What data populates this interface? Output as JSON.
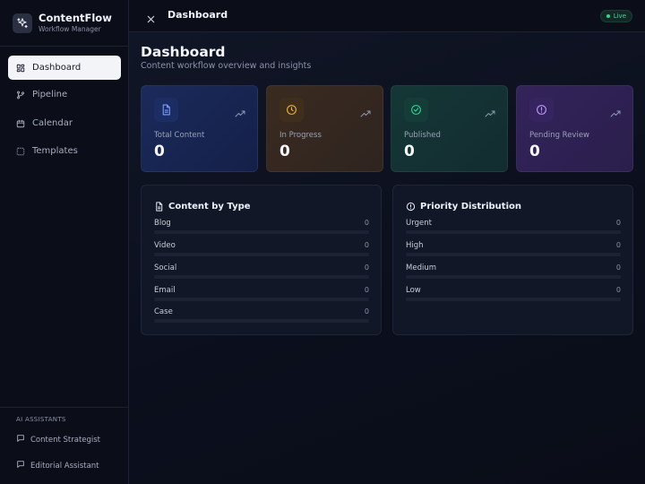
{
  "brand": {
    "name": "ContentFlow",
    "subtitle": "Workflow Manager"
  },
  "sidebar": {
    "nav": [
      {
        "label": "Dashboard",
        "icon": "grid-icon",
        "active": true
      },
      {
        "label": "Pipeline",
        "icon": "branch-icon",
        "active": false
      },
      {
        "label": "Calendar",
        "icon": "calendar-icon",
        "active": false
      },
      {
        "label": "Templates",
        "icon": "template-icon",
        "active": false
      }
    ],
    "ai_heading": "AI ASSISTANTS",
    "ai_items": [
      {
        "label": "Content Strategist",
        "icon": "chat-icon"
      },
      {
        "label": "Editorial Assistant",
        "icon": "chat-icon"
      }
    ]
  },
  "header": {
    "title": "Dashboard",
    "live_label": "Live"
  },
  "page": {
    "title": "Dashboard",
    "subtitle": "Content workflow overview and insights"
  },
  "stats": [
    {
      "label": "Total Content",
      "value": "0",
      "icon": "document-icon",
      "color": "#5b7cfa"
    },
    {
      "label": "In Progress",
      "value": "0",
      "icon": "clock-icon",
      "color": "#f2b33d"
    },
    {
      "label": "Published",
      "value": "0",
      "icon": "check-circle-icon",
      "color": "#34d399"
    },
    {
      "label": "Pending Review",
      "value": "0",
      "icon": "alert-circle-icon",
      "color": "#b48af7"
    }
  ],
  "content_by_type": {
    "title": "Content by Type",
    "rows": [
      {
        "label": "Blog",
        "count": "0",
        "fraction": 0
      },
      {
        "label": "Video",
        "count": "0",
        "fraction": 0
      },
      {
        "label": "Social",
        "count": "0",
        "fraction": 0
      },
      {
        "label": "Email",
        "count": "0",
        "fraction": 0
      },
      {
        "label": "Case",
        "count": "0",
        "fraction": 0
      }
    ]
  },
  "priority_distribution": {
    "title": "Priority Distribution",
    "rows": [
      {
        "label": "Urgent",
        "count": "0",
        "fraction": 0
      },
      {
        "label": "High",
        "count": "0",
        "fraction": 0
      },
      {
        "label": "Medium",
        "count": "0",
        "fraction": 0
      },
      {
        "label": "Low",
        "count": "0",
        "fraction": 0
      }
    ]
  }
}
